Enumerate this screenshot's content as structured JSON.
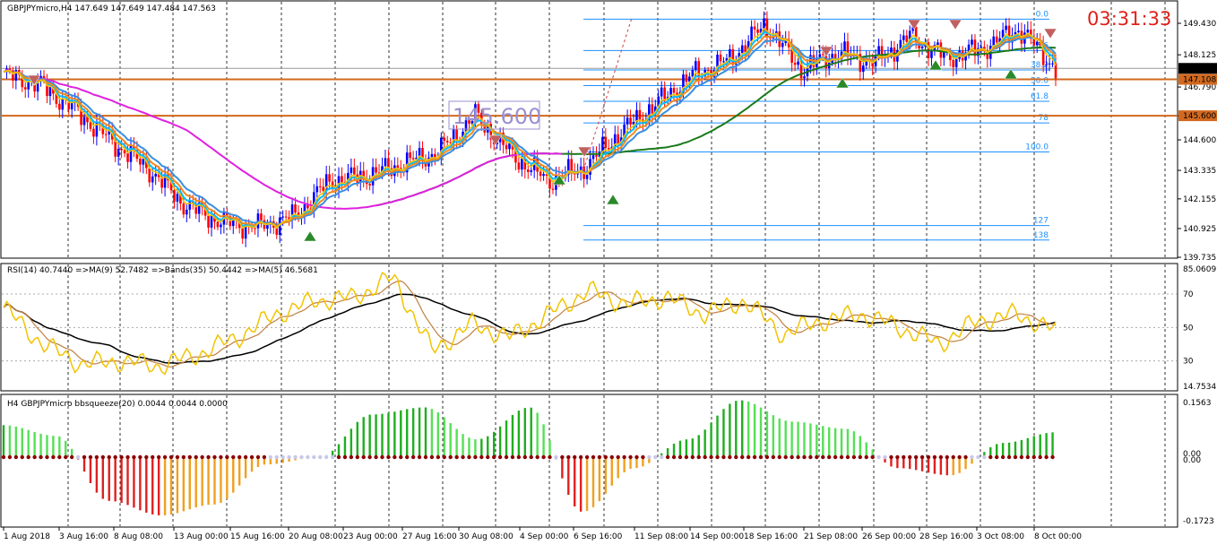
{
  "symbol_header": "GBPJPYmicro,H4  147.649 147.649 147.484 147.563",
  "clock": "03:31:33",
  "level_box_label": "145.600",
  "price_axis": {
    "ticks": [
      "149.430",
      "148.125",
      "146.790",
      "145.600",
      "144.600",
      "143.335",
      "142.155",
      "140.925",
      "139.735"
    ],
    "tick_values": [
      149.43,
      148.125,
      146.79,
      145.6,
      144.6,
      143.335,
      142.155,
      140.925,
      139.735
    ],
    "current_price": "147.563",
    "current_value": 147.563,
    "h_line_upper": "147.108",
    "h_line_upper_value": 147.108,
    "h_line_lower": "145.600",
    "h_line_lower_value": 145.6
  },
  "fib_levels": [
    "0.0",
    "23.6",
    "38.2",
    "50.0",
    "61.8",
    "78",
    "100.0",
    "127",
    "138"
  ],
  "fib_values": [
    149.6,
    148.3,
    147.5,
    146.85,
    146.2,
    145.3,
    144.1,
    141.05,
    140.45
  ],
  "rsi_header": "RSI(14) 40.7440  =>MA(9) 52.7482  =>Bands(35) 50.4442  =>MA(5) 46.5681",
  "rsi_axis": {
    "ticks": [
      "85.0609",
      "70",
      "50",
      "30",
      "14.7534"
    ],
    "tick_values": [
      85.0609,
      70,
      50,
      30,
      14.7534
    ]
  },
  "squeeze_header": "H4 GBPJPYmicro bbsqueeze(20) 0.0044 0.0044 0.0000",
  "squeeze_axis": {
    "ticks": [
      "0.1563",
      "0.00",
      "0.00",
      "-0.1723"
    ],
    "tick_values": [
      0.1563,
      0.003,
      -0.003,
      -0.1723
    ]
  },
  "time_axis": [
    "1 Aug 2018",
    "3 Aug 16:00",
    "8 Aug 08:00",
    "13 Aug 00:00",
    "15 Aug 16:00",
    "20 Aug 08:00",
    "23 Aug 00:00",
    "27 Aug 16:00",
    "30 Aug 08:00",
    "4 Sep 00:00",
    "6 Sep 16:00",
    "11 Sep 08:00",
    "14 Sep 00:00",
    "18 Sep 16:00",
    "21 Sep 08:00",
    "26 Sep 00:00",
    "28 Sep 16:00",
    "3 Oct 08:00",
    "8 Oct 00:00"
  ],
  "colors": {
    "bull": "#0000ff",
    "bear": "#ff0000",
    "ma_fast": "#00bfff",
    "ma_mid": "#3a8fe0",
    "ma_orange": "#f08a1c",
    "ma_yellow": "#f2c400",
    "ma_magenta": "#e020e0",
    "ma_green": "#1a7a1a",
    "hline": "#d2691e",
    "fib": "#1e90ff",
    "rsi_line": "#f2c400",
    "rsi_ma": "#c08040",
    "rsi_band": "#000000",
    "sq_pos": "#1fae1f",
    "sq_pos_light": "#55e055",
    "sq_neg": "#e02020",
    "sq_neg_light": "#f0a020",
    "sq_dot": "#8b0000"
  },
  "chart_data": {
    "type": "line",
    "title": "GBPJPYmicro,H4",
    "x_labels": [
      "1 Aug 2018",
      "3 Aug 16:00",
      "8 Aug 08:00",
      "13 Aug 00:00",
      "15 Aug 16:00",
      "20 Aug 08:00",
      "23 Aug 00:00",
      "27 Aug 16:00",
      "30 Aug 08:00",
      "4 Sep 00:00",
      "6 Sep 16:00",
      "11 Sep 08:00",
      "14 Sep 00:00",
      "18 Sep 16:00",
      "21 Sep 08:00",
      "26 Sep 00:00",
      "28 Sep 16:00",
      "3 Oct 08:00",
      "8 Oct 00:00"
    ],
    "close_keypoints": [
      147.3,
      146.9,
      145.8,
      144.5,
      143.4,
      141.9,
      141.2,
      141.0,
      141.4,
      142.9,
      143.1,
      143.6,
      144.1,
      145.6,
      144.0,
      142.9,
      143.4,
      144.9,
      146.1,
      147.3,
      147.9,
      149.4,
      147.5,
      148.2,
      147.8,
      148.9,
      148.0,
      148.4,
      149.2,
      147.56
    ],
    "ylim": [
      139.735,
      150.1
    ],
    "rsi_values": [
      62,
      40,
      28,
      30,
      27,
      34,
      44,
      58,
      66,
      68,
      80,
      36,
      52,
      44,
      58,
      72,
      64,
      68,
      58,
      66,
      46,
      54,
      58,
      50,
      40,
      54,
      58,
      48
    ],
    "squeeze_values": [
      0.09,
      0.06,
      -0.12,
      -0.16,
      -0.13,
      -0.02,
      0.0,
      0.12,
      0.14,
      0.05,
      0.14,
      -0.15,
      -0.03,
      0.05,
      0.16,
      0.1,
      0.08,
      -0.03,
      -0.05,
      0.04,
      0.07
    ]
  }
}
